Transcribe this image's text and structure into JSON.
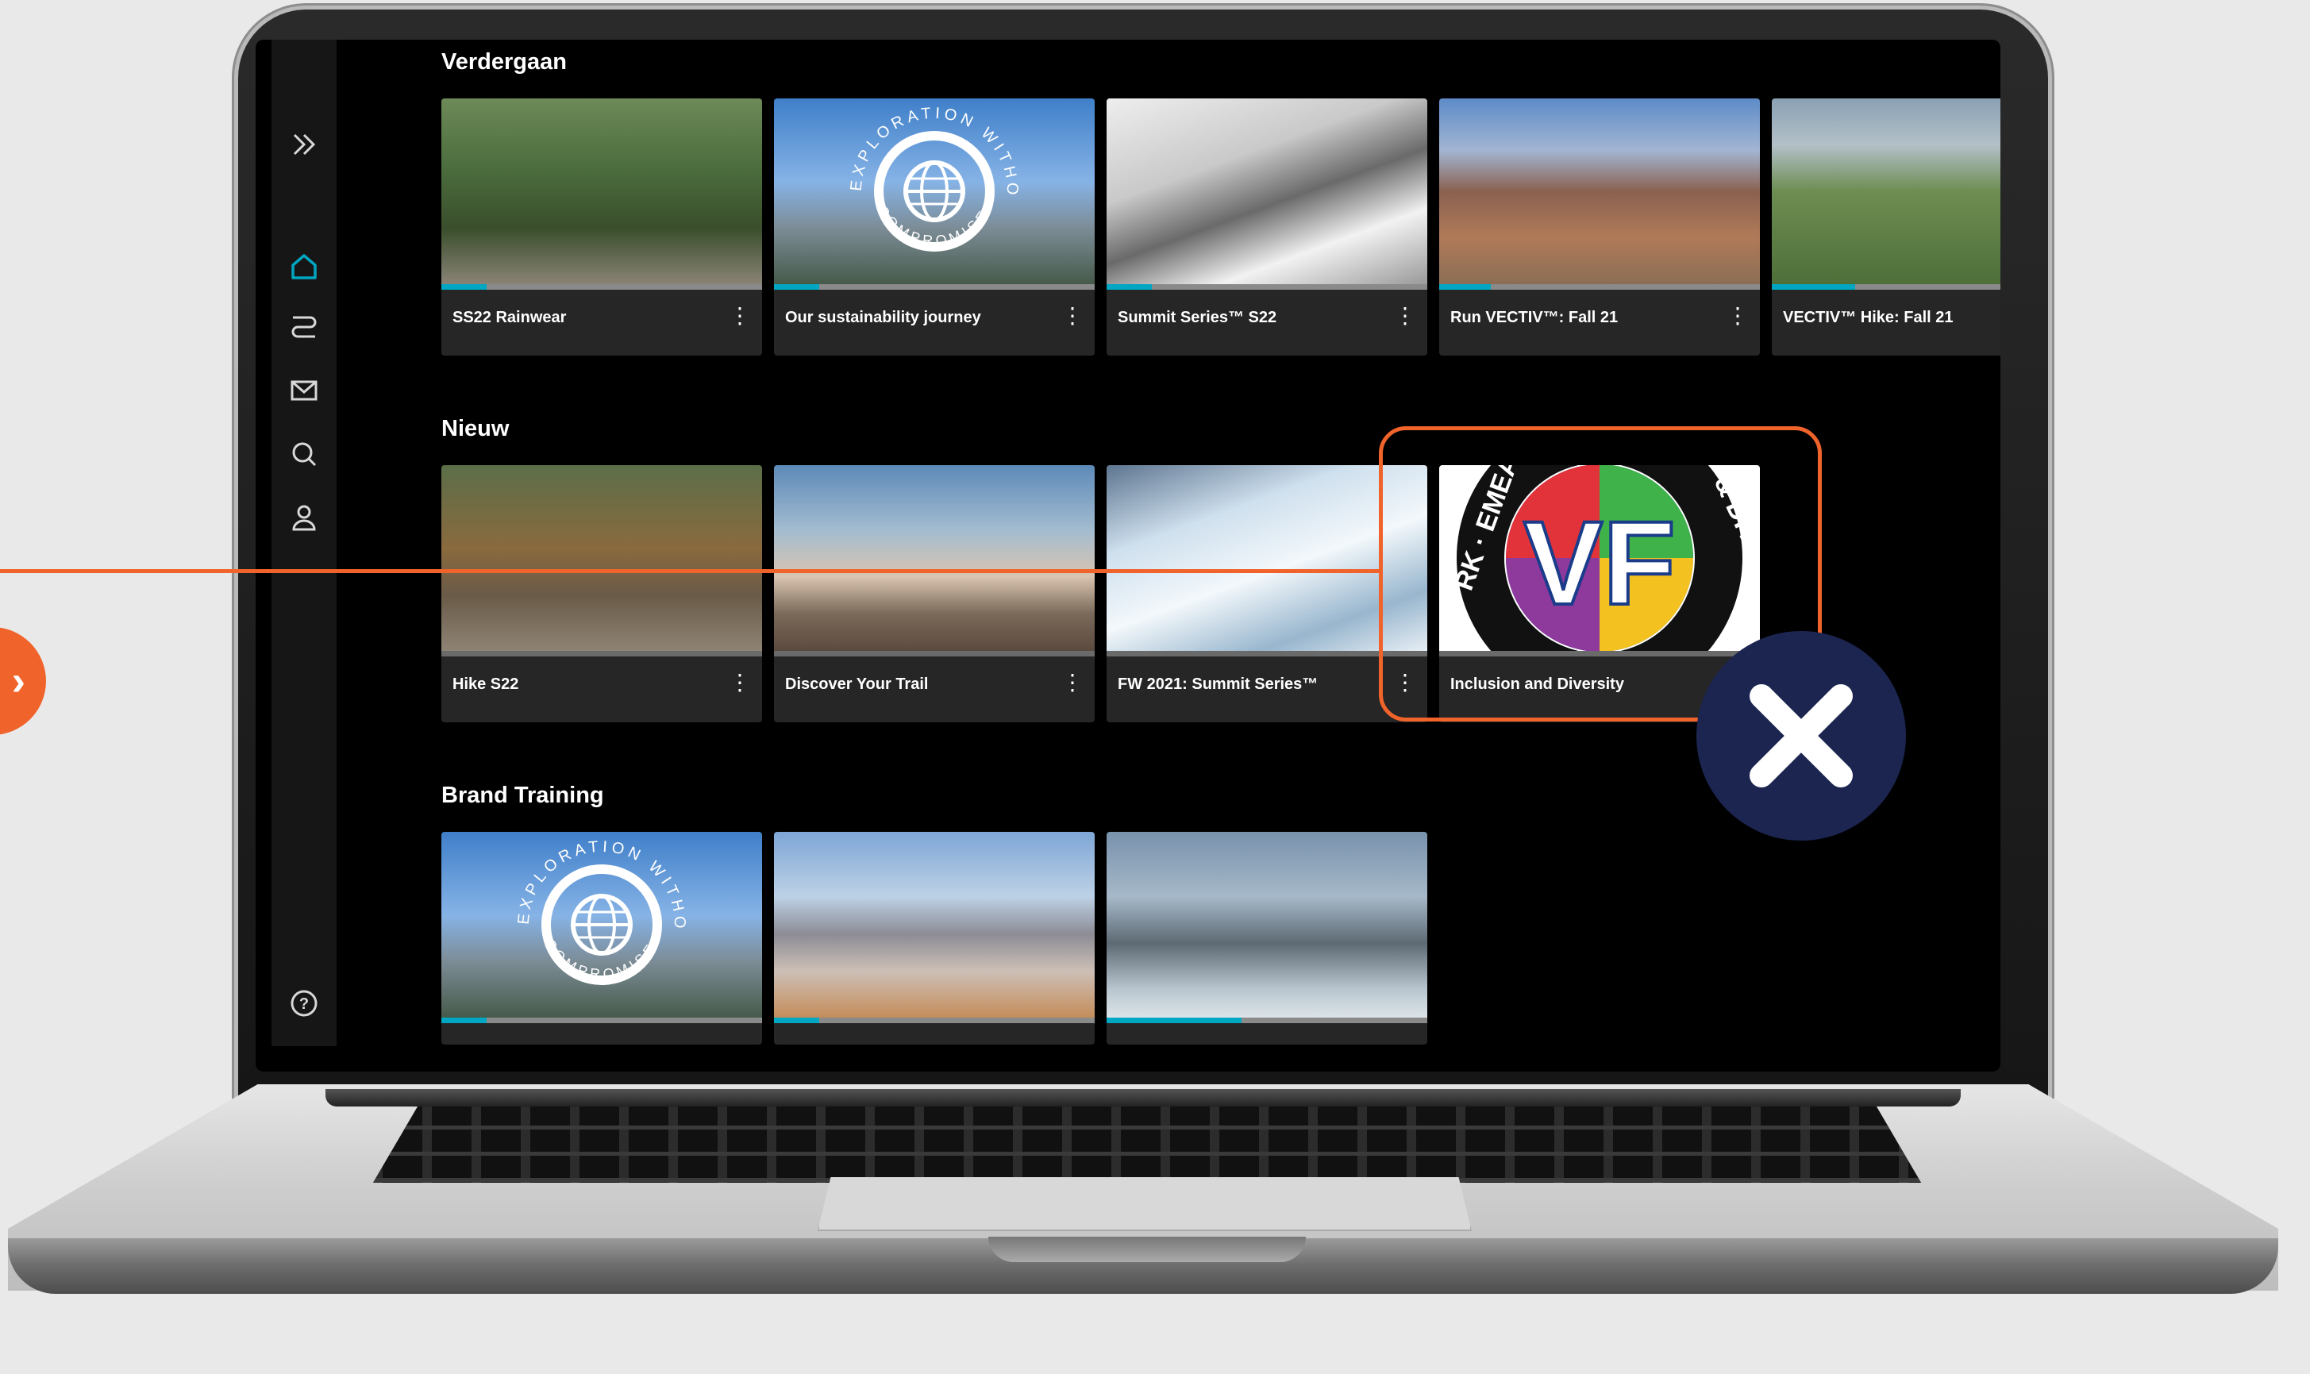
{
  "sidebar": {
    "icons": [
      "expand-icon",
      "home-icon",
      "learning-path-icon",
      "mail-icon",
      "search-icon",
      "profile-icon",
      "help-icon"
    ],
    "accent": "#00a6c2"
  },
  "rows": [
    {
      "title": "Verdergaan",
      "cards": [
        {
          "title": "SS22 Rainwear",
          "progress": 0.14
        },
        {
          "title": "Our sustainability journey",
          "progress": 0.14,
          "badge": true
        },
        {
          "title": "Summit Series™ S22",
          "progress": 0.14
        },
        {
          "title": "Run VECTIV™: Fall 21",
          "progress": 0.16
        },
        {
          "title": "VECTIV™ Hike: Fall 21",
          "progress": 0.26
        }
      ]
    },
    {
      "title": "Nieuw",
      "cards": [
        {
          "title": "Hike S22"
        },
        {
          "title": "Discover Your Trail"
        },
        {
          "title": "FW 2021: Summit Series™"
        },
        {
          "title": "Inclusion and Diversity"
        }
      ]
    },
    {
      "title": "Brand Training",
      "cards": [
        {
          "progress": 0.14,
          "badge": true
        },
        {
          "progress": 0.14
        },
        {
          "progress": 0.42
        }
      ]
    }
  ],
  "badge": {
    "top_text": "EXPLORATION WITHOUT",
    "bottom_text": "COMPROMISE"
  },
  "vf_badge": {
    "logo": "VF",
    "ring_text_left": "RK · EMEA",
    "ring_text_right": "& DIVERSI"
  },
  "colors": {
    "highlight": "#f0632a",
    "close_circle": "#1b2550"
  },
  "overlay_icons": [
    "chevron-right-icon",
    "close-icon"
  ]
}
